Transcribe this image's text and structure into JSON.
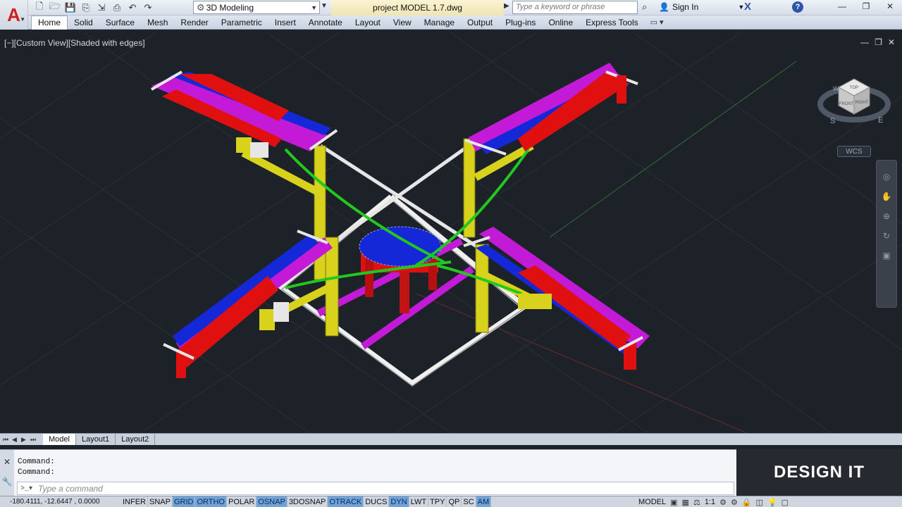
{
  "app": {
    "logo_letter": "A",
    "workspace": "3D Modeling",
    "document_title": "project MODEL 1.7.dwg",
    "search_placeholder": "Type a keyword or phrase",
    "sign_in": "Sign In"
  },
  "ribbon": {
    "tabs": [
      "Home",
      "Solid",
      "Surface",
      "Mesh",
      "Render",
      "Parametric",
      "Insert",
      "Annotate",
      "Layout",
      "View",
      "Manage",
      "Output",
      "Plug-ins",
      "Online",
      "Express Tools"
    ],
    "active": "Home"
  },
  "viewport": {
    "label": "[−][Custom View][Shaded with edges]",
    "viewcube": {
      "top": "TOP",
      "front": "FRONT",
      "right": "RIGHT",
      "s": "S",
      "e": "E",
      "w": "W"
    },
    "wcs": "WCS"
  },
  "layout_tabs": [
    "Model",
    "Layout1",
    "Layout2"
  ],
  "command": {
    "history": [
      "Command:",
      "Command:"
    ],
    "placeholder": "Type a command"
  },
  "brand": "DESIGN IT",
  "status": {
    "coords": "-180.4111, -12.6447 , 0.0000",
    "toggles": [
      {
        "label": "INFER",
        "on": false
      },
      {
        "label": "SNAP",
        "on": false
      },
      {
        "label": "GRID",
        "on": true
      },
      {
        "label": "ORTHO",
        "on": true
      },
      {
        "label": "POLAR",
        "on": false
      },
      {
        "label": "OSNAP",
        "on": true
      },
      {
        "label": "3DOSNAP",
        "on": false
      },
      {
        "label": "OTRACK",
        "on": true
      },
      {
        "label": "DUCS",
        "on": false
      },
      {
        "label": "DYN",
        "on": true
      },
      {
        "label": "LWT",
        "on": false
      },
      {
        "label": "TPY",
        "on": false
      },
      {
        "label": "QP",
        "on": false
      },
      {
        "label": "SC",
        "on": false
      },
      {
        "label": "AM",
        "on": true
      }
    ],
    "model_label": "MODEL",
    "scale": "1:1"
  },
  "colors": {
    "magenta": "#c21ad6",
    "yellow": "#d9d21c",
    "red": "#e01010",
    "blue": "#1428d8",
    "green": "#22c81e",
    "white": "#e6e6e6"
  }
}
